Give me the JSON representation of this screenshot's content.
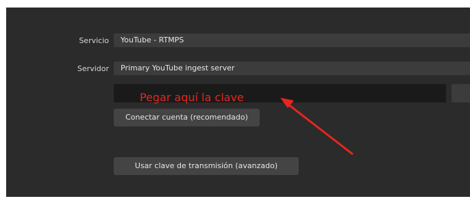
{
  "settings": {
    "service_label": "Servicio",
    "service_value": "YouTube - RTMPS",
    "server_label": "Servidor",
    "server_value": "Primary YouTube ingest server",
    "connect_button": "Conectar cuenta (recomendado)",
    "use_key_button": "Usar clave de transmisión (avanzado)"
  },
  "annotation": {
    "text": "Pegar aquí la clave",
    "color": "#e8251f",
    "icon": "red-arrow"
  }
}
